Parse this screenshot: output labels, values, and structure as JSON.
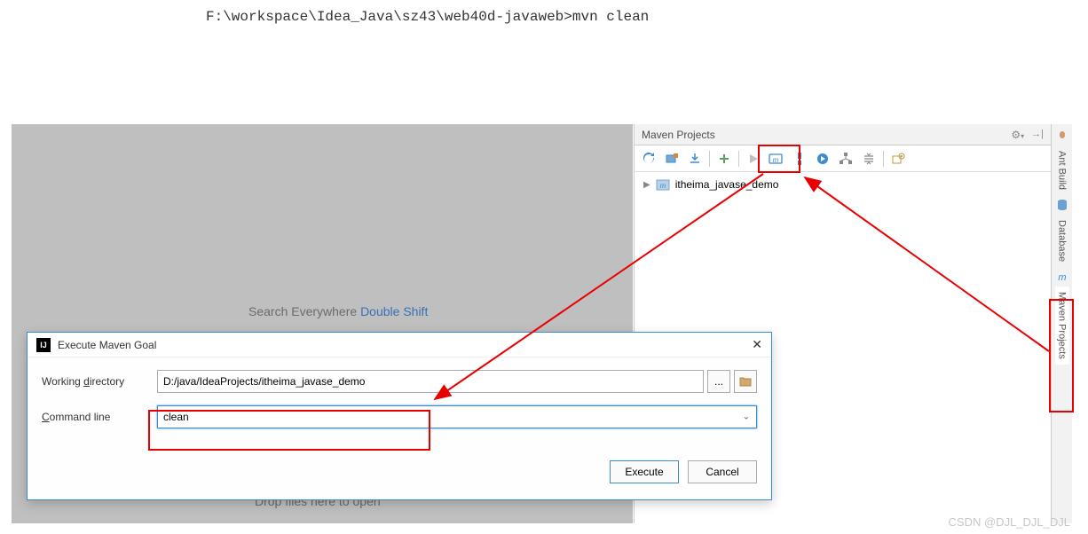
{
  "terminal": {
    "command": "F:\\workspace\\Idea_Java\\sz43\\web40d-javaweb>mvn clean"
  },
  "editor": {
    "search_label": "Search Everywhere ",
    "search_shortcut": "Double Shift",
    "drop_label": "Drop files here to open"
  },
  "maven_panel": {
    "title": "Maven Projects",
    "project": "itheima_javase_demo"
  },
  "right_tabs": {
    "ant": "Ant Build",
    "database": "Database",
    "maven": "Maven Projects"
  },
  "dialog": {
    "title": "Execute Maven Goal",
    "wd_label_pre": "Working ",
    "wd_label_u": "d",
    "wd_label_post": "irectory",
    "wd_value": "D:/java/IdeaProjects/itheima_javase_demo",
    "cmd_label_u": "C",
    "cmd_label_post": "ommand line",
    "cmd_value": "clean",
    "execute": "Execute",
    "cancel": "Cancel",
    "browse": "..."
  },
  "watermark": "CSDN @DJL_DJL_DJL",
  "colors": {
    "red": "#e80000",
    "blue": "#3b8bd1"
  }
}
